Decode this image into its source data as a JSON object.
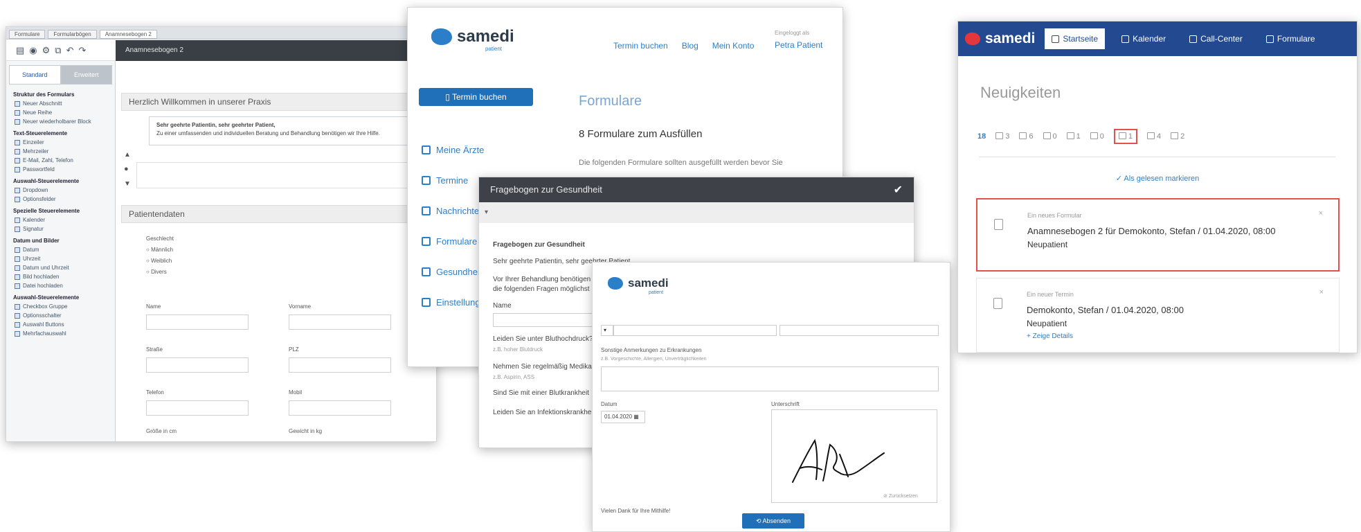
{
  "editor": {
    "tabs": [
      "Formulare",
      "Formularbögen",
      "Anamnesebogen 2"
    ],
    "header_title": "Anamnesebogen 2",
    "side_tabs": [
      "Standard",
      "Erweitert"
    ],
    "sections": [
      {
        "title": "Struktur des Formulars",
        "items": [
          "Neuer Abschnitt",
          "Neue Reihe",
          "Neuer wiederholbarer Block"
        ]
      },
      {
        "title": "Text-Steuerelemente",
        "items": [
          "Einzeiler",
          "Mehrzeiler",
          "E-Mail, Zahl, Telefon",
          "Passwortfeld"
        ]
      },
      {
        "title": "Auswahl-Steuerelemente",
        "items": [
          "Dropdown",
          "Optionsfelder"
        ]
      },
      {
        "title": "Spezielle Steuerelemente",
        "items": [
          "Kalender",
          "Signatur"
        ]
      },
      {
        "title": "Datum und Bilder",
        "items": [
          "Datum",
          "Uhrzeit",
          "Datum und Uhrzeit",
          "Bild hochladen",
          "Datei hochladen"
        ]
      },
      {
        "title": "Auswahl-Steuerelemente",
        "items": [
          "Checkbox Gruppe",
          "Optionsschalter",
          "Auswahl Buttons",
          "Mehrfachauswahl"
        ]
      }
    ],
    "group1_title": "Herzlich Willkommen in unserer Praxis",
    "box_text_bold": "Sehr geehrte Patientin, sehr geehrter Patient,",
    "box_text": "Zu einer umfassenden und individuellen Beratung und Behandlung benötigen wir Ihre Hilfe.",
    "group2_title": "Patientendaten",
    "gender_label": "Geschlecht",
    "genders": [
      "Männlich",
      "Weiblich",
      "Divers"
    ],
    "fields": [
      {
        "label": "Name"
      },
      {
        "label": "Vorname"
      },
      {
        "label": "Straße"
      },
      {
        "label": "PLZ"
      },
      {
        "label": "Telefon"
      },
      {
        "label": "Mobil"
      },
      {
        "label": "Größe in cm"
      },
      {
        "label": "Gewicht in kg"
      }
    ]
  },
  "portal": {
    "logo": "samedi",
    "logo_sub": "patient",
    "nav": [
      "Termin buchen",
      "Blog",
      "Mein Konto"
    ],
    "user_caption": "Eingeloggt als",
    "user_name": "Petra Patient",
    "book_button": "Termin buchen",
    "menu": [
      "Meine Ärzte",
      "Termine",
      "Nachrichten",
      "Formulare",
      "Gesundheit",
      "Einstellungen"
    ],
    "heading": "Formulare",
    "subheading": "8 Formulare zum Ausfüllen",
    "text": "Die folgenden Formulare sollten ausgefüllt werden bevor Sie"
  },
  "questionnaire": {
    "title": "Fragebogen zur Gesundheit",
    "q_title": "Fragebogen zur Gesundheit",
    "greeting": "Sehr geehrte Patientin, sehr geehrter Patient,",
    "intro1": "Vor Ihrer Behandlung benötigen wir",
    "intro2": "die folgenden Fragen möglichst",
    "name_label": "Name",
    "q1": "Leiden Sie unter Bluthochdruck?",
    "q1_hint": "z.B. hoher Blutdruck",
    "q2": "Nehmen Sie regelmäßig Medikamente?",
    "q2_hint": "z.B. Aspirin, ASS",
    "q3": "Sind Sie mit einer Blutkrankheit",
    "q4": "Leiden Sie an Infektionskrankheiten?"
  },
  "signature_form": {
    "logo": "samedi",
    "logo_sub": "patient",
    "remarks_label": "Sonstige Anmerkungen zu Erkrankungen",
    "remarks_hint": "z.B. Vorgeschichte, Allergien, Unverträglichkeiten",
    "date_label": "Datum",
    "date_value": "01.04.2020",
    "signature_label": "Unterschrift",
    "clear_label": "Zurücksetzen",
    "footer_text": "Vielen Dank für Ihre Mithilfe!",
    "submit": "Absenden"
  },
  "dashboard": {
    "logo": "samedi",
    "nav": [
      "Startseite",
      "Kalender",
      "Call-Center",
      "Formulare"
    ],
    "heading": "Neuigkeiten",
    "counts": [
      "18",
      "3",
      "6",
      "0",
      "1",
      "0",
      "1",
      "4",
      "2"
    ],
    "mark_read": "✓ Als gelesen markieren",
    "cards": [
      {
        "kind": "Ein neues Formular",
        "main": "Anamnesebogen 2 für Demokonto, Stefan / 01.04.2020, 08:00",
        "sub": "Neupatient"
      },
      {
        "kind": "Ein neuer Termin",
        "main": "Demokonto, Stefan / 01.04.2020, 08:00",
        "sub": "Neupatient",
        "details": "+ Zeige Details"
      }
    ],
    "close": "×",
    "colors": {
      "navy": "#234990",
      "highlight": "#e4504a",
      "link": "#2b7fc9"
    }
  }
}
